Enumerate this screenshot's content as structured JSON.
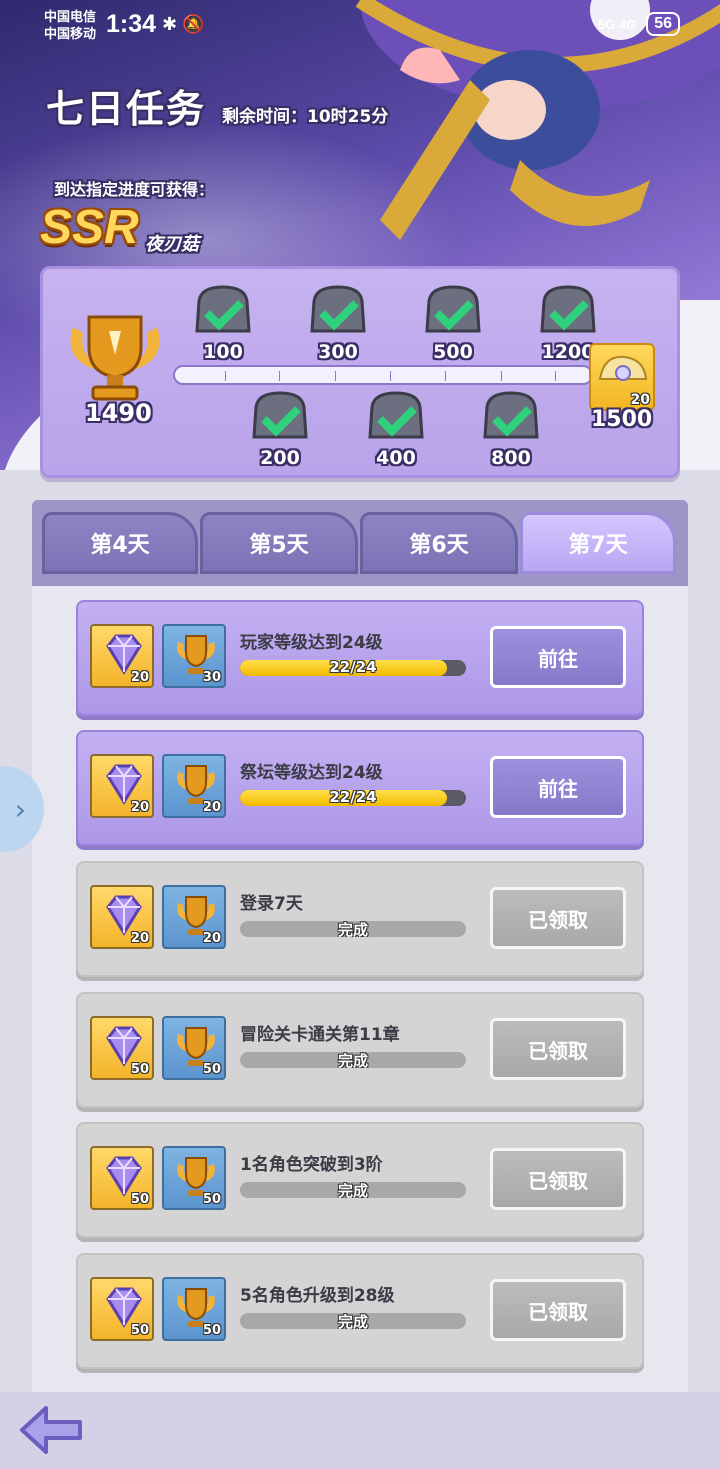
{
  "status_bar": {
    "carrier_1": "中国电信",
    "carrier_2": "中国移动",
    "time": "1:34",
    "icons_left": "✱ 🔕",
    "signal_text": "5G 4G",
    "battery": "56"
  },
  "header": {
    "title": "七日任务",
    "time_left": "剩余时间：10时25分",
    "reach_text": "到达指定进度可获得：",
    "reward_rank": "SSR",
    "reward_name": "夜刃菇"
  },
  "progress": {
    "current_score": "1490",
    "milestones_top": [
      "100",
      "300",
      "500",
      "1200"
    ],
    "milestones_bottom": [
      "200",
      "400",
      "800"
    ],
    "final_value": "1500",
    "final_count": "20"
  },
  "tabs": [
    {
      "label": "第4天"
    },
    {
      "label": "第5天"
    },
    {
      "label": "第6天"
    },
    {
      "label": "第7天"
    }
  ],
  "tasks": [
    {
      "name": "玩家等级达到24级",
      "gem": "20",
      "trophy": "30",
      "progress_text": "22/24",
      "progress": 0.917,
      "button": "前往",
      "state": "active"
    },
    {
      "name": "祭坛等级达到24级",
      "gem": "20",
      "trophy": "20",
      "progress_text": "22/24",
      "progress": 0.917,
      "button": "前往",
      "state": "active"
    },
    {
      "name": "登录7天",
      "gem": "20",
      "trophy": "20",
      "progress_text": "完成",
      "progress": 1,
      "button": "已领取",
      "state": "done"
    },
    {
      "name": "冒险关卡通关第11章",
      "gem": "50",
      "trophy": "50",
      "progress_text": "完成",
      "progress": 1,
      "button": "已领取",
      "state": "done"
    },
    {
      "name": "1名角色突破到3阶",
      "gem": "50",
      "trophy": "50",
      "progress_text": "完成",
      "progress": 1,
      "button": "已领取",
      "state": "done"
    },
    {
      "name": "5名角色升级到28级",
      "gem": "50",
      "trophy": "50",
      "progress_text": "完成",
      "progress": 1,
      "button": "已领取",
      "state": "done"
    }
  ],
  "colors": {
    "accent_purple": "#9d91de",
    "gold": "#f2b800",
    "panel": "#c6b3f0"
  }
}
